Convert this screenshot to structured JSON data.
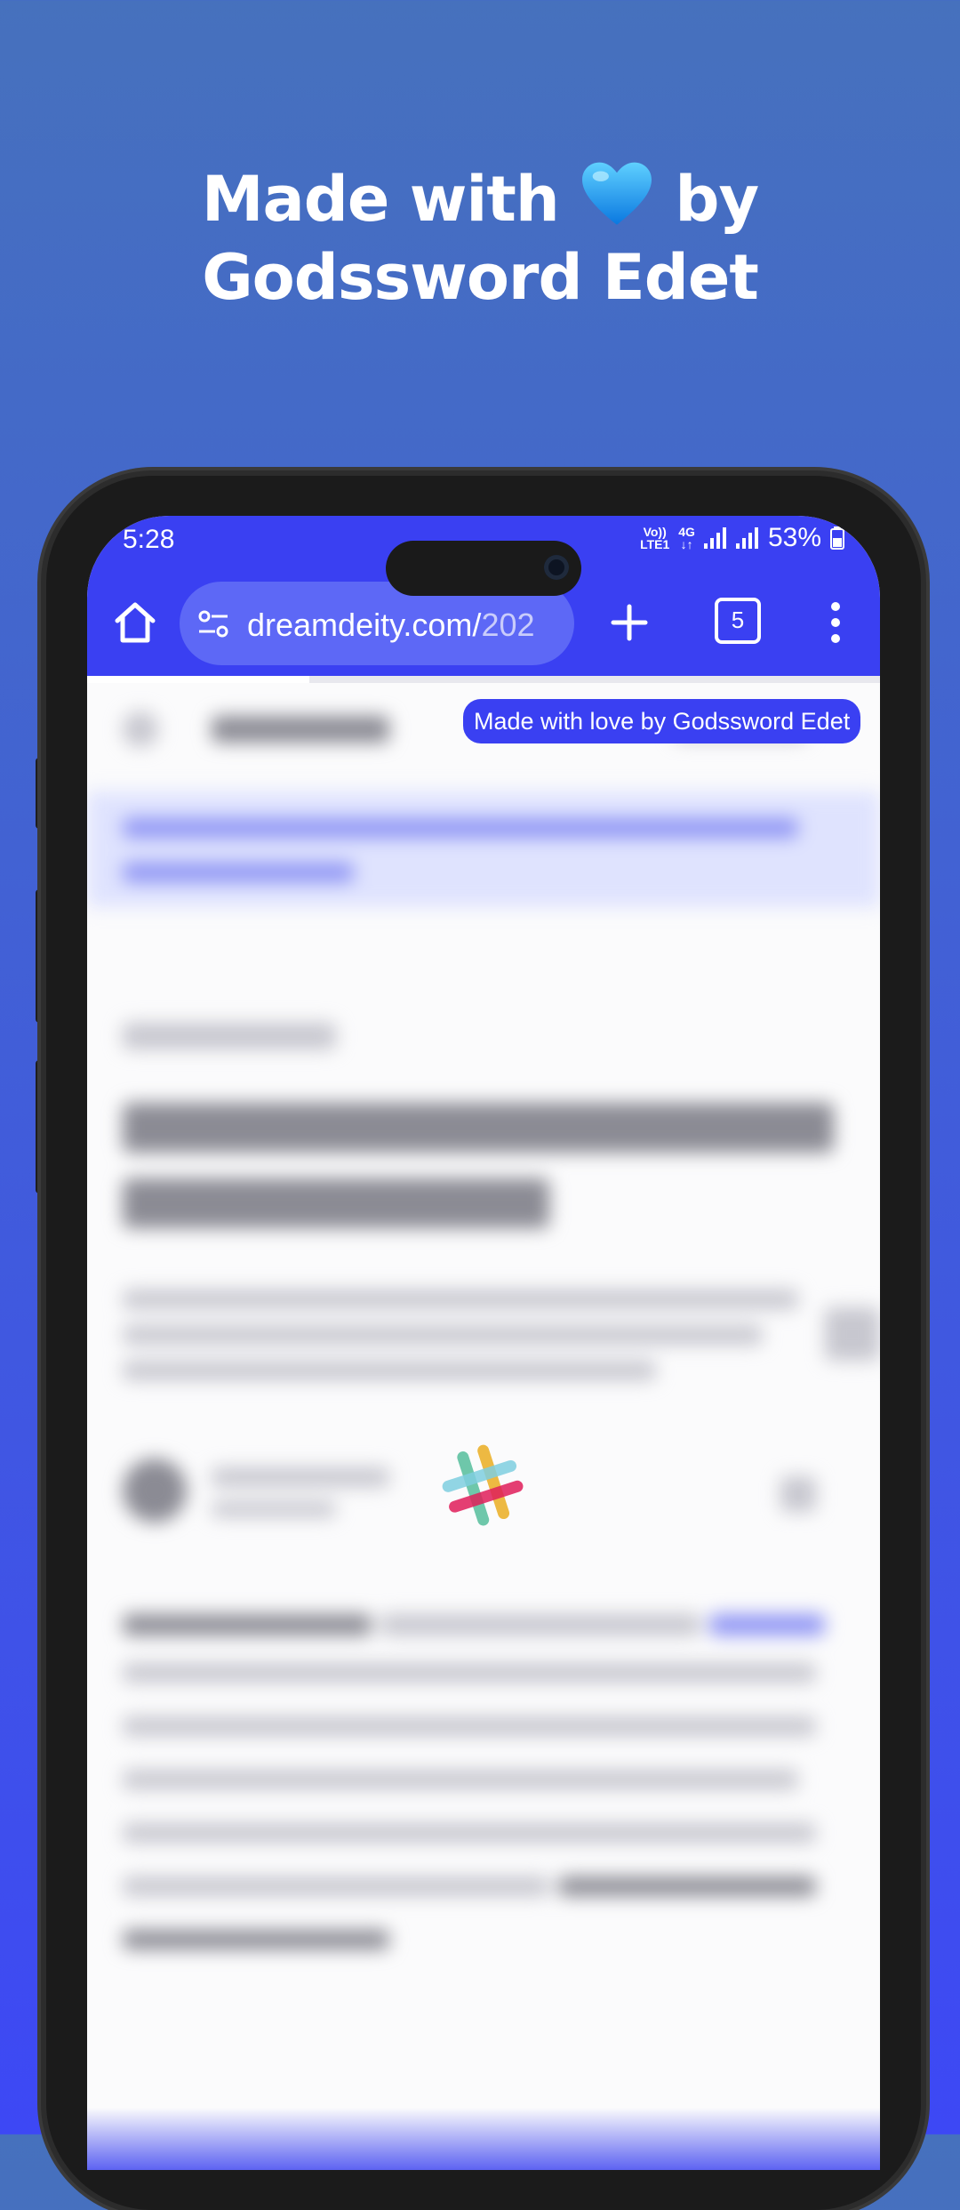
{
  "promo": {
    "headline_line1_before": "Made with",
    "headline_line1_after": "by",
    "headline_line2": "Godssword Edet",
    "heart_icon": "blue-heart-icon",
    "background_top": "#4671bd",
    "background_bottom": "#3d48f5"
  },
  "status_bar": {
    "time": "5:28",
    "network_top": "Vo))",
    "network_bottom": "LTE1",
    "network_type": "4G",
    "battery": "53%"
  },
  "browser": {
    "home_icon": "home-icon",
    "site_settings_icon": "site-settings-icon",
    "url_main": "dreamdeity.com/",
    "url_faded": "202",
    "new_tab_icon": "plus-icon",
    "tab_count": "5",
    "menu_icon": "more-vert-icon",
    "toolbar_color": "#3a40f2",
    "load_progress": 0.28
  },
  "page": {
    "badge": "Made with love by Godssword Edet",
    "loader_icon": "slack-logo-icon"
  }
}
